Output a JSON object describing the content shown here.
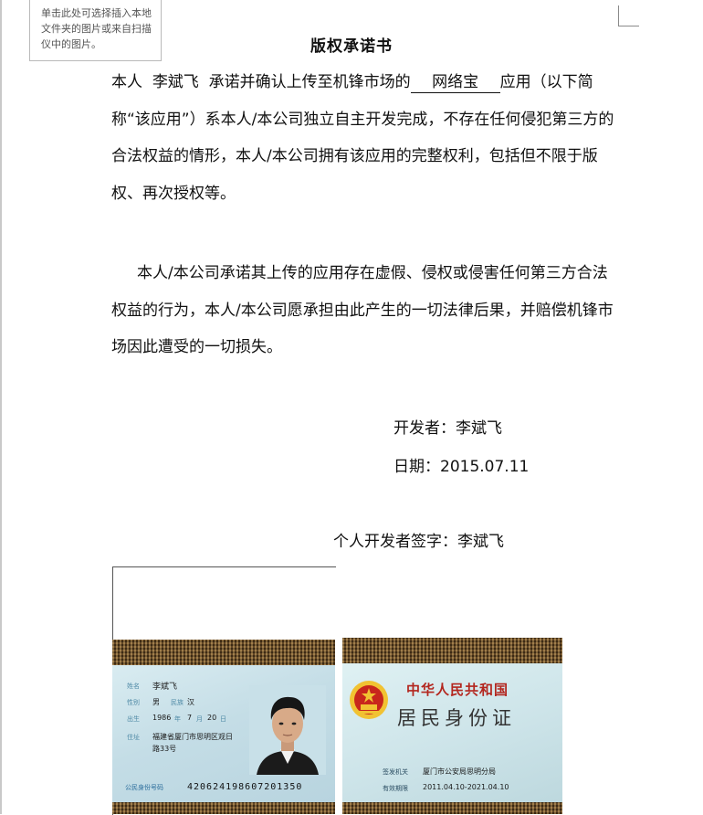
{
  "placeholder": {
    "text": "单击此处可选择插入本地文件夹的图片或来自扫描仪中的图片。"
  },
  "document": {
    "title": "版权承诺书",
    "para1": {
      "prefix": "本人",
      "name": "李斌飞",
      "mid": "承诺并确认上传至机锋市场的",
      "app_name": "网络宝",
      "suffix": "应用（以下简称“该应用”）系本人/本公司独立自主开发完成，不存在任何侵犯第三方的合法权益的情形，本人/本公司拥有该应用的完整权利，包括但不限于版权、再次授权等。"
    },
    "para2": "本人/本公司承诺其上传的应用存在虚假、侵权或侵害任何第三方合法权益的行为，本人/本公司愿承担由此产生的一切法律后果，并赔偿机锋市场因此遭受的一切损失。",
    "developer_line": "开发者：李斌飞",
    "date_line": "日期：2015.07.11",
    "signature_line": "个人开发者签字：李斌飞"
  },
  "id_front": {
    "name_label": "姓名",
    "name": "李斌飞",
    "gender_label": "性别",
    "gender": "男",
    "ethnicity_label": "民族",
    "ethnicity": "汉",
    "birth_label": "出生",
    "birth_year": "1986",
    "year_unit": "年",
    "birth_month": "7",
    "month_unit": "月",
    "birth_day": "20",
    "day_unit": "日",
    "address_label": "住址",
    "address_line1": "福建省厦门市思明区观日",
    "address_line2": "路33号",
    "id_number_label": "公民身份号码",
    "id_number": "420624198607201350"
  },
  "id_back": {
    "nation": "中华人民共和国",
    "card_name": "居民身份证",
    "authority_label": "签发机关",
    "authority": "厦门市公安局思明分局",
    "validity_label": "有效期限",
    "validity": "2011.04.10-2021.04.10"
  },
  "colors": {
    "wood": "#6b4a22",
    "card_blue": "#c4dde6",
    "emblem_red": "#c8261c",
    "emblem_gold": "#f1c232"
  }
}
